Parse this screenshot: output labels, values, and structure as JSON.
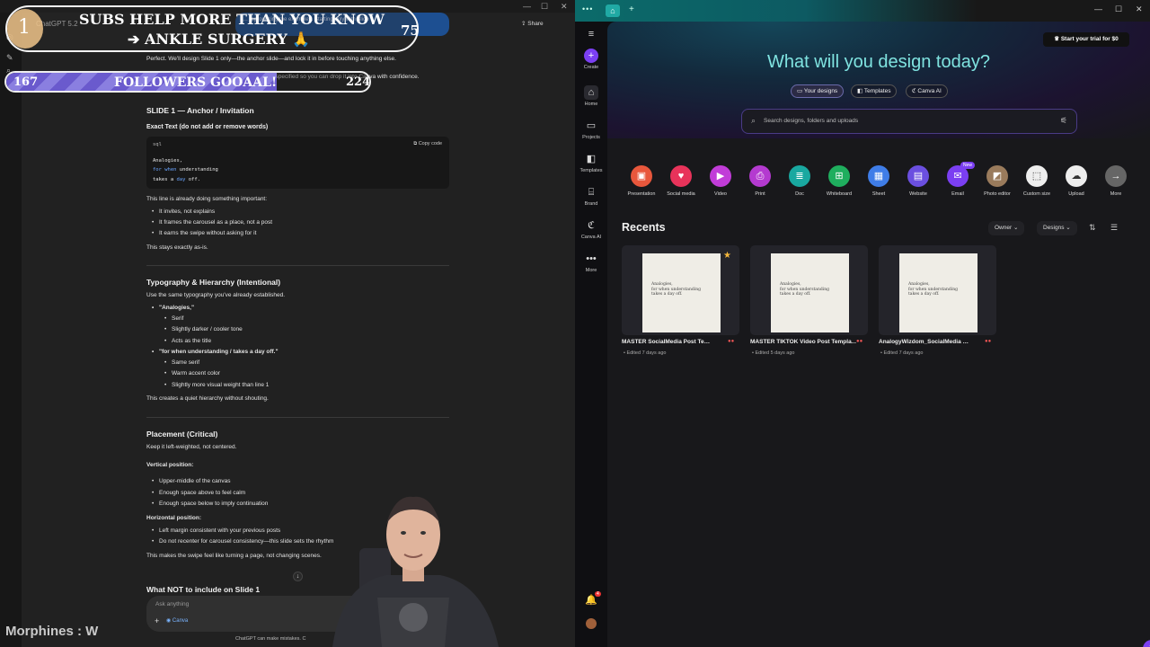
{
  "chatgpt": {
    "title": "ChatGPT 5.2",
    "share": "Share",
    "user_bubble": "… reproducing the examples. Starting only with Slide 1.",
    "intro_line": "Perfect. We'll design Slide 1 only—the anchor slide—and lock it in before touching anything else.",
    "intro_line2": "…specified so you can drop it into Canva with confidence.",
    "slide_heading": "SLIDE 1 — Anchor / Invitation",
    "exact_text_heading": "Exact Text (do not add or remove words)",
    "code": {
      "lang": "sql",
      "copy": "Copy code",
      "line1": "Analogies,",
      "line2_kw": "for when",
      "line2_rest": " understanding",
      "line3_a": "takes a ",
      "line3_kw": "day",
      "line3_b": " off."
    },
    "line_important": "This line is already doing something important:",
    "bullets_important": [
      "It invites, not explains",
      "It frames the carousel as a place, not a post",
      "It earns the swipe without asking for it"
    ],
    "stays": "This stays exactly as-is.",
    "typo_heading": "Typography & Hierarchy (Intentional)",
    "typo_intro": "Use the same typography you've already established.",
    "analogies_label": "\"Analogies,\"",
    "analogies_bullets": [
      "Serif",
      "Slightly darker / cooler tone",
      "Acts as the title"
    ],
    "forwhen_label": "\"for when understanding / takes a day off.\"",
    "forwhen_bullets": [
      "Same serif",
      "Warm accent color",
      "Slightly more visual weight than line 1"
    ],
    "quiet": "This creates a quiet hierarchy without shouting.",
    "placement_heading": "Placement (Critical)",
    "placement_intro": "Keep it left-weighted, not centered.",
    "vertical_label": "Vertical position:",
    "vertical_bullets": [
      "Upper-middle of the canvas",
      "Enough space above to feel calm",
      "Enough space below to imply continuation"
    ],
    "horizontal_label": "Horizontal position:",
    "horizontal_bullets": [
      "Left margin consistent with your previous posts",
      "Do not recenter for carousel consistency—this slide sets the rhythm"
    ],
    "swipe_line": "This makes the swipe feel like turning a page, not changing scenes.",
    "not_include_heading": "What NOT to include on Slide 1",
    "ask_placeholder": "Ask anything",
    "canva_chip": "Canva",
    "footer": "ChatGPT can make mistakes. C"
  },
  "overlay": {
    "goal_number": "1",
    "subs_line1": "SUBS HELP MORE THAN YOU KNOW",
    "subs_line2": "➔ ANKLE SURGERY 🙏",
    "subs_count": "75",
    "followers_current": "167",
    "followers_label": "FOLLOWERS GOOAAL!",
    "followers_goal": "224",
    "followers_progress": 0.745,
    "watermark": "Morphines : W"
  },
  "canva": {
    "trial_button": "Start your trial for $0",
    "hero_title": "What will you design today?",
    "tabs": [
      "Your designs",
      "Templates",
      "Canva AI"
    ],
    "search_placeholder": "Search designs, folders and uploads",
    "sidebar": [
      "Create",
      "Home",
      "Projects",
      "Templates",
      "Brand",
      "Canva AI",
      "More"
    ],
    "quick_actions": [
      {
        "label": "Presentation",
        "color": "#e8573c",
        "icon": "presentation-icon"
      },
      {
        "label": "Social media",
        "color": "#e8335a",
        "icon": "heart-icon"
      },
      {
        "label": "Video",
        "color": "#c13cd8",
        "icon": "video-icon"
      },
      {
        "label": "Print",
        "color": "#b43ad0",
        "icon": "print-icon"
      },
      {
        "label": "Doc",
        "color": "#19a8a0",
        "icon": "doc-icon"
      },
      {
        "label": "Whiteboard",
        "color": "#1fae5e",
        "icon": "whiteboard-icon"
      },
      {
        "label": "Sheet",
        "color": "#3f7de8",
        "icon": "sheet-icon"
      },
      {
        "label": "Website",
        "color": "#6b4fe0",
        "icon": "website-icon"
      },
      {
        "label": "Email",
        "color": "#7b3ff2",
        "icon": "email-icon"
      },
      {
        "label": "Photo editor",
        "color": "#9a7b5c",
        "icon": "photo-editor-icon"
      },
      {
        "label": "Custom size",
        "color": "#eeeeee",
        "icon": "custom-size-icon"
      },
      {
        "label": "Upload",
        "color": "#eeeeee",
        "icon": "upload-icon"
      },
      {
        "label": "More",
        "color": "#666666",
        "icon": "more-icon"
      }
    ],
    "new_badge": "New",
    "recents_title": "Recents",
    "owner_filter": "Owner",
    "designs_filter": "Designs",
    "thumb_text": [
      "Analogies,",
      "for when understanding",
      "takes a day off."
    ],
    "recents": [
      {
        "name": "MASTER SocialMedia Post Te…",
        "meta": "• Edited 7 days ago",
        "starred": true
      },
      {
        "name": "MASTER TIKTOK Video Post Templa…",
        "meta": "• Edited 5 days ago",
        "starred": false
      },
      {
        "name": "AnalogyWizdom_SocialMedia …",
        "meta": "• Edited 7 days ago",
        "starred": false
      }
    ],
    "notification_count": "4",
    "help": "?"
  },
  "colors": {
    "canva_purple": "#7b3ff2",
    "hero_text": "#7fe3e0",
    "chatgpt_bg": "#212121"
  }
}
